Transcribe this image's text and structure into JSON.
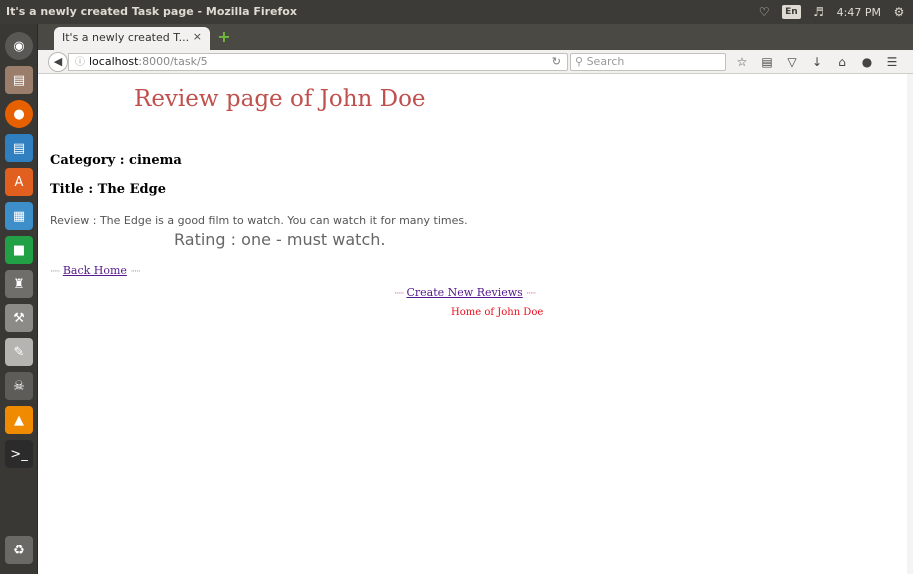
{
  "window": {
    "title": "It's a newly created Task page - Mozilla Firefox"
  },
  "tray": {
    "language": "En",
    "time": "4:47 PM",
    "icons": [
      "wifi-icon",
      "language-icon",
      "volume-icon",
      "gear-icon"
    ]
  },
  "launcher": {
    "items": [
      "dash-icon",
      "files-icon",
      "firefox-icon",
      "writer-icon",
      "software-center-icon",
      "calc-icon",
      "pycharm-icon",
      "app-icon",
      "tools-icon",
      "editor-icon",
      "terminal-like-icon",
      "vlc-icon",
      "terminal-icon",
      "trash-icon"
    ]
  },
  "browser": {
    "tab": {
      "title": "It's a newly created T...",
      "close": "×"
    },
    "new_tab": "+",
    "url": {
      "host": "localhost",
      "path": ":8000/task/5"
    },
    "search": {
      "placeholder": "Search"
    },
    "toolbar_icons": [
      "star-icon",
      "reading-list-icon",
      "pocket-icon",
      "download-icon",
      "home-icon",
      "chat-icon",
      "menu-icon"
    ]
  },
  "page": {
    "heading": "Review page of John Doe",
    "category": "Category : cinema",
    "title": "Title : The Edge",
    "review": "Review : The Edge is a good film to watch. You can watch it for many times.",
    "rating": "Rating : one - must watch.",
    "back_home": {
      "prefix": "·····",
      "label": "Back Home",
      "suffix": "·····"
    },
    "create_new": {
      "prefix": "·····",
      "label": "Create New Reviews",
      "suffix": "·····"
    },
    "home_of": "Home of John Doe"
  },
  "colors": {
    "heading": "#c0504d",
    "home_of": "#e8101e",
    "link": "#1a0dab",
    "visited_link": "#551a8b"
  }
}
